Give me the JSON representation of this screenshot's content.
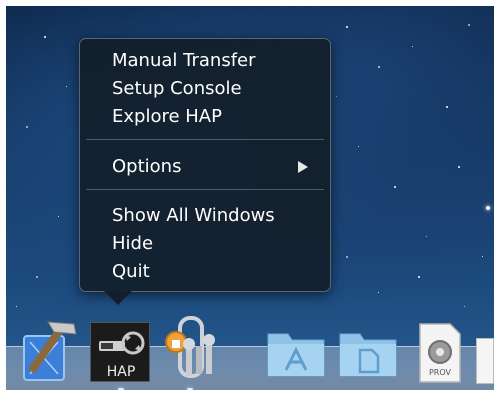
{
  "menu": {
    "group1": [
      "Manual Transfer",
      "Setup Console",
      "Explore HAP"
    ],
    "options_label": "Options",
    "group3": [
      "Show All Windows",
      "Hide",
      "Quit"
    ]
  },
  "dock": {
    "hap_label": "HAP",
    "prov_label": "PROV"
  }
}
